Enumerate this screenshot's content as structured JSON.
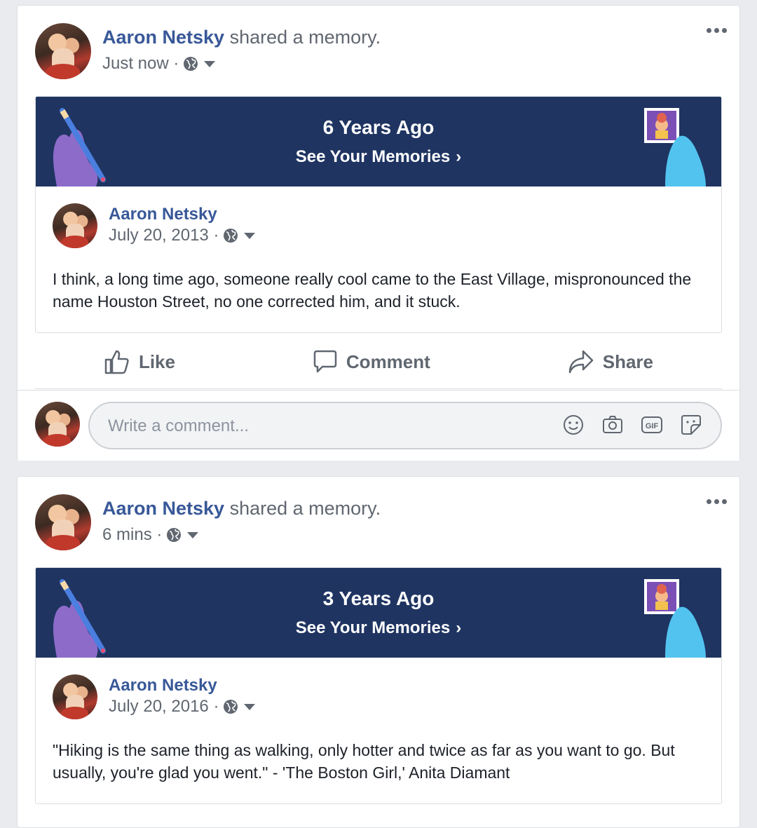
{
  "posts": [
    {
      "author": "Aaron Netsky",
      "action": " shared a memory.",
      "time": "Just now",
      "memory": {
        "title": "6 Years Ago",
        "link": "See Your Memories",
        "shared_author": "Aaron Netsky",
        "shared_date": "July 20, 2013",
        "text": "I think, a long time ago, someone really cool came to the East Village, mispronounced the name Houston Street, no one corrected him, and it stuck."
      },
      "actions": {
        "like": "Like",
        "comment": "Comment",
        "share": "Share"
      },
      "comment_placeholder": "Write a comment..."
    },
    {
      "author": "Aaron Netsky",
      "action": " shared a memory.",
      "time": "6 mins",
      "memory": {
        "title": "3 Years Ago",
        "link": "See Your Memories",
        "shared_author": "Aaron Netsky",
        "shared_date": "July 20, 2016",
        "text": "\"Hiking is the same thing as walking, only hotter and twice as far as you want to go. But usually, you're glad you went.\" - 'The Boston Girl,' Anita Diamant"
      }
    }
  ],
  "icons": {
    "more": "more-options-icon",
    "privacy": "globe-icon",
    "like": "thumbs-up-icon",
    "comment": "speech-bubble-icon",
    "share": "share-arrow-icon",
    "emoji": "smiley-icon",
    "photo": "camera-icon",
    "gif": "gif-icon",
    "sticker": "sticker-icon"
  },
  "colors": {
    "link_blue": "#385898",
    "banner_navy": "#1f3461",
    "secondary_text": "#606770",
    "background": "#e9ebee"
  }
}
